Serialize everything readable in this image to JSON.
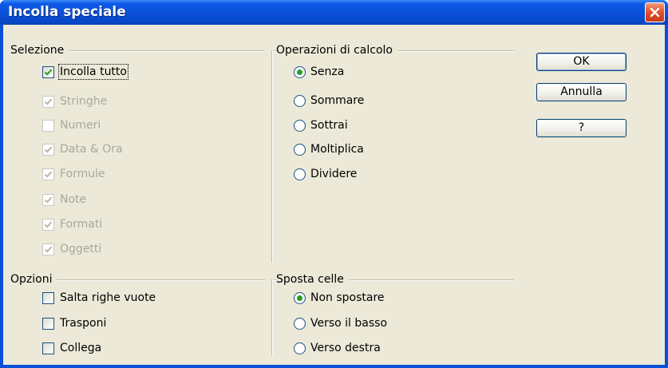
{
  "window": {
    "title": "Incolla speciale"
  },
  "selezione": {
    "label": "Selezione",
    "items": [
      {
        "label": "Incolla tutto",
        "checked": true,
        "enabled": true
      },
      {
        "label": "Stringhe",
        "checked": true,
        "enabled": false
      },
      {
        "label": "Numeri",
        "checked": false,
        "enabled": false
      },
      {
        "label": "Data & Ora",
        "checked": true,
        "enabled": false
      },
      {
        "label": "Formule",
        "checked": true,
        "enabled": false
      },
      {
        "label": "Note",
        "checked": true,
        "enabled": false
      },
      {
        "label": "Formati",
        "checked": true,
        "enabled": false
      },
      {
        "label": "Oggetti",
        "checked": true,
        "enabled": false
      }
    ]
  },
  "operazioni": {
    "label": "Operazioni di calcolo",
    "items": [
      {
        "label": "Senza",
        "selected": true
      },
      {
        "label": "Sommare",
        "selected": false
      },
      {
        "label": "Sottrai",
        "selected": false
      },
      {
        "label": "Moltiplica",
        "selected": false
      },
      {
        "label": "Dividere",
        "selected": false
      }
    ]
  },
  "opzioni": {
    "label": "Opzioni",
    "items": [
      {
        "label": "Salta righe vuote",
        "checked": false
      },
      {
        "label": "Trasponi",
        "checked": false
      },
      {
        "label": "Collega",
        "checked": false
      }
    ]
  },
  "sposta": {
    "label": "Sposta celle",
    "items": [
      {
        "label": "Non spostare",
        "selected": true
      },
      {
        "label": "Verso il basso",
        "selected": false
      },
      {
        "label": "Verso destra",
        "selected": false
      }
    ]
  },
  "buttons": {
    "ok": "OK",
    "cancel": "Annulla",
    "help": "?"
  },
  "colors": {
    "title_bar": "#0a4fd8",
    "dialog_bg": "#ece9d8",
    "radio_dot": "#21a121",
    "close_button": "#e0502a"
  }
}
